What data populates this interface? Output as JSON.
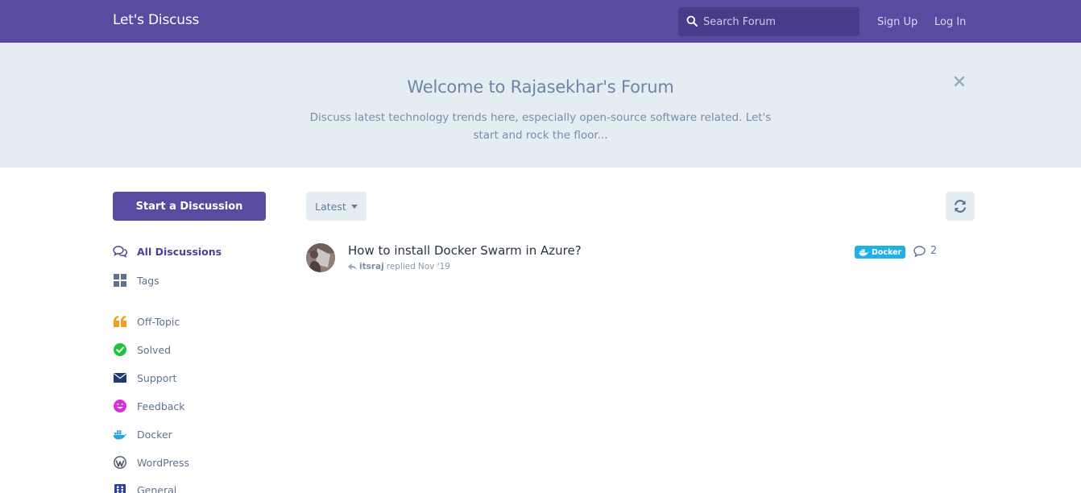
{
  "header": {
    "brand": "Let's Discuss",
    "search_placeholder": "Search Forum",
    "signup_label": "Sign Up",
    "login_label": "Log In"
  },
  "hero": {
    "title": "Welcome to Rajasekhar's Forum",
    "description": "Discuss latest technology trends here, especially open-source software related. Let's start and rock the floor..."
  },
  "sidebar": {
    "start_button": "Start a Discussion",
    "items": [
      {
        "label": "All Discussions",
        "icon": "comments-icon",
        "active": true
      },
      {
        "label": "Tags",
        "icon": "tags-grid-icon"
      },
      {
        "label": "Off-Topic",
        "icon": "quote-icon",
        "color": "#f0a020"
      },
      {
        "label": "Solved",
        "icon": "check-circle-icon",
        "color": "#22c040"
      },
      {
        "label": "Support",
        "icon": "envelope-icon",
        "color": "#1f3a6e"
      },
      {
        "label": "Feedback",
        "icon": "smile-icon",
        "color": "#d432d8"
      },
      {
        "label": "Docker",
        "icon": "docker-icon",
        "color": "#2aa6de"
      },
      {
        "label": "WordPress",
        "icon": "wordpress-icon",
        "color": "#4a5566"
      },
      {
        "label": "General",
        "icon": "grid-icon",
        "color": "#2a3fa0"
      }
    ]
  },
  "toolbar": {
    "sort_label": "Latest"
  },
  "discussions": [
    {
      "title": "How to install Docker Swarm in Azure?",
      "user": "itsraj",
      "action": "replied",
      "time": "Nov '19",
      "tag": "Docker",
      "replies": "2"
    }
  ],
  "colors": {
    "brand": "#5a4ba0",
    "hero_bg": "#e3edf2",
    "docker_tag": "#20b0e8"
  }
}
